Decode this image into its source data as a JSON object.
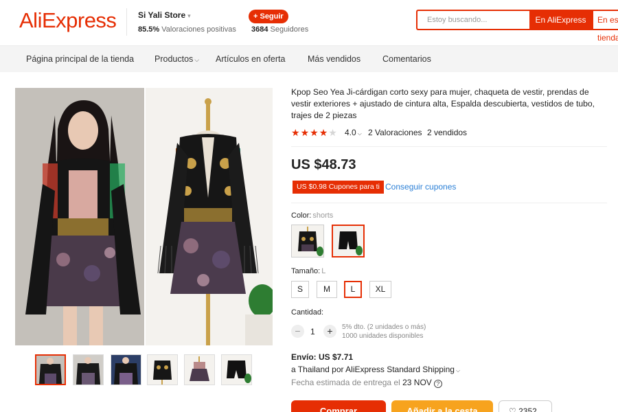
{
  "header": {
    "logo": "AliExpress",
    "store_name": "Si Yali Store",
    "rating_pct": "85.5%",
    "rating_text": "Valoraciones positivas",
    "follow_label": "+ Seguir",
    "followers_count": "3684",
    "followers_text": "Seguidores",
    "search_placeholder": "Estoy buscando...",
    "search_aliexpress": "En AliExpress",
    "search_store": "En esta tienda"
  },
  "nav": {
    "items": [
      "Página principal de la tienda",
      "Productos",
      "Artículos en oferta",
      "Más vendidos",
      "Comentarios"
    ]
  },
  "product": {
    "title": "Kpop Seo Yea Ji-cárdigan corto sexy para mujer, chaqueta de vestir, prendas de vestir exteriores + ajustado de cintura alta, Espalda descubierta, vestidos de tubo, trajes de 2 piezas",
    "stars_filled": 4,
    "rating": "4.0",
    "reviews": "2 Valoraciones",
    "sold": "2 vendidos",
    "price": "US $48.73",
    "coupon": "US $0.98 Cupones para ti",
    "coupon_link": "Conseguir cupones"
  },
  "color": {
    "label": "Color:",
    "selected": "shorts",
    "options": [
      "jacket-dress",
      "shorts"
    ]
  },
  "size": {
    "label": "Tamaño:",
    "selected": "L",
    "options": [
      "S",
      "M",
      "L",
      "XL"
    ]
  },
  "quantity": {
    "label": "Cantidad:",
    "value": "1",
    "discount_note": "5% dto. (2 unidades o más)",
    "available": "1000 unidades disponibles"
  },
  "shipping": {
    "title": "Envío: US $7.71",
    "method": "a Thailand por AliExpress Standard Shipping",
    "delivery_prefix": "Fecha estimada de entrega el",
    "delivery_date": "23 NOV"
  },
  "actions": {
    "buy": "Comprar",
    "cart": "Añadir a la cesta",
    "wishlist_count": "2352"
  },
  "colors": {
    "accent": "#e62e04",
    "cart": "#f7a31e",
    "link": "#2a7fd6"
  }
}
